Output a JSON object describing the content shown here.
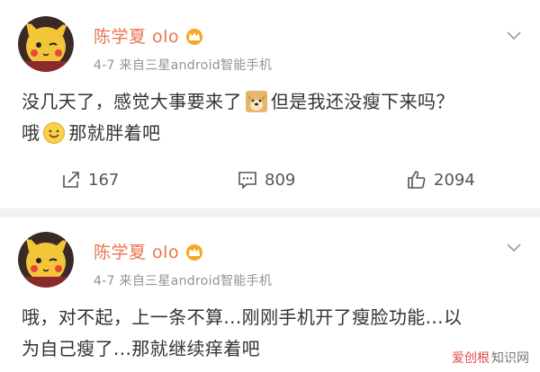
{
  "posts": [
    {
      "username": "陈学夏 olo",
      "meta": "4-7  来自三星android智能手机",
      "text_line1a": "没几天了，感觉大事要来了",
      "text_line1b": "但是我还没瘦下来吗？",
      "text_line2a": "哦",
      "text_line2b": "那就胖着吧",
      "repost_count": "167",
      "comment_count": "809",
      "like_count": "2094"
    },
    {
      "username": "陈学夏 olo",
      "meta": "4-7  来自三星android智能手机",
      "text_line1": "哦，对不起，上一条不算...刚刚手机开了瘦脸功能...以",
      "text_line2": "为自己瘦了...那就继续痒着吧"
    }
  ],
  "watermark": {
    "brand": "爱创根",
    "site": "知识网"
  },
  "colors": {
    "username": "#eb7350",
    "meta": "#939393",
    "text": "#333333",
    "divider": "#f2f2f2"
  },
  "icons": [
    "avatar-pikachu",
    "crown-badge-icon",
    "chevron-down-icon",
    "doge-emoji-icon",
    "smile-emoji-icon",
    "repost-icon",
    "comment-icon",
    "like-icon"
  ]
}
